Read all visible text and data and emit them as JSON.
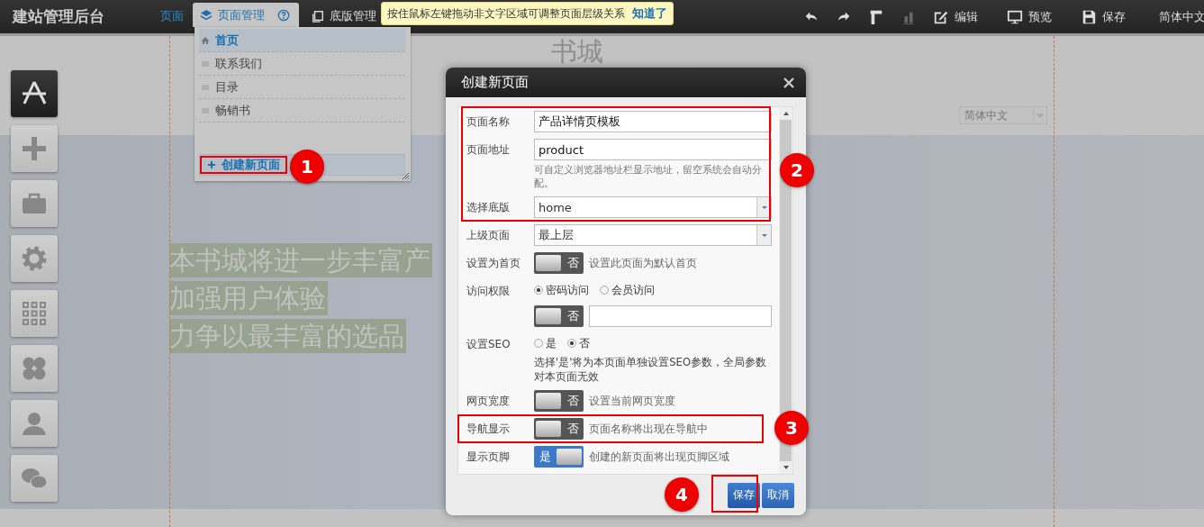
{
  "top_bar": {
    "title": "建站管理后台",
    "tabs": [
      {
        "label": "页面",
        "kind": "plain",
        "selected": false
      },
      {
        "label": "页面管理",
        "kind": "menu",
        "selected": true
      },
      {
        "label": "底版管理",
        "kind": "copy",
        "selected": false
      }
    ],
    "tools": [
      {
        "kind": "undo",
        "disabled": false
      },
      {
        "kind": "redo",
        "disabled": false
      },
      {
        "kind": "ruler",
        "disabled": false
      },
      {
        "kind": "chart",
        "disabled": true
      },
      {
        "kind": "edit",
        "label": "编辑",
        "disabled": false
      },
      {
        "kind": "preview",
        "label": "预览",
        "disabled": false
      },
      {
        "kind": "save",
        "label": "保存",
        "disabled": false
      }
    ],
    "language": "简体中文"
  },
  "tooltip": {
    "text": "按住鼠标左键拖动非文字区域可调整页面层级关系",
    "link": "知道了"
  },
  "page_menu": {
    "items": [
      {
        "label": "首页",
        "selected": true
      },
      {
        "label": "联系我们",
        "selected": false
      },
      {
        "label": "目录",
        "selected": false
      },
      {
        "label": "畅销书",
        "selected": false
      }
    ],
    "create_button": "创建新页面"
  },
  "site": {
    "logo": "书城",
    "language_select": "简体中文",
    "slogan": [
      "本书城将进一步丰富产",
      "加强用户体验",
      "力争以最丰富的选品"
    ]
  },
  "left_toolbar": [
    {
      "kind": "design",
      "selected": true
    },
    {
      "kind": "add",
      "selected": false
    },
    {
      "kind": "toolbox",
      "selected": false
    },
    {
      "kind": "settings",
      "selected": false
    },
    {
      "kind": "grid",
      "selected": false
    },
    {
      "kind": "clover",
      "selected": false
    },
    {
      "kind": "user",
      "selected": false
    },
    {
      "kind": "chat",
      "selected": false
    }
  ],
  "dialog": {
    "title": "创建新页面",
    "fields": [
      {
        "kind": "text",
        "label": "页面名称",
        "value": "产品详情页模板"
      },
      {
        "kind": "text",
        "label": "页面地址",
        "value": "product",
        "hint": "可自定义浏览器地址栏显示地址，留空系统会自动分配。"
      },
      {
        "kind": "select",
        "label": "选择底版",
        "value": "home"
      },
      {
        "kind": "select",
        "label": "上级页面",
        "value": "最上层"
      },
      {
        "kind": "toggle",
        "label": "设置为首页",
        "on": false,
        "toggle_label": "否",
        "note": "设置此页面为默认首页"
      },
      {
        "kind": "radio",
        "label": "访问权限",
        "options": [
          {
            "label": "密码访问",
            "selected": true
          },
          {
            "label": "会员访问",
            "selected": false
          }
        ],
        "extra_toggle": {
          "on": false,
          "toggle_label": "否"
        }
      },
      {
        "kind": "radio",
        "label": "设置SEO",
        "options": [
          {
            "label": "是",
            "selected": false
          },
          {
            "label": "否",
            "selected": true
          }
        ],
        "note": "选择'是'将为本页面单独设置SEO参数，全局参数对本页面无效"
      },
      {
        "kind": "toggle",
        "label": "网页宽度",
        "on": false,
        "toggle_label": "否",
        "note": "设置当前网页宽度"
      },
      {
        "kind": "toggle",
        "label": "导航显示",
        "on": false,
        "toggle_label": "否",
        "note": "页面名称将出现在导航中"
      },
      {
        "kind": "toggle",
        "label": "显示页脚",
        "on": true,
        "toggle_label": "是",
        "note": "创建的新页面将出现页脚区域"
      }
    ],
    "buttons": [
      {
        "label": "保存",
        "kind": "primary"
      },
      {
        "label": "取消",
        "kind": "secondary"
      }
    ]
  },
  "annotations": [
    {
      "number": "1"
    },
    {
      "number": "2"
    },
    {
      "number": "3"
    },
    {
      "number": "4"
    }
  ]
}
